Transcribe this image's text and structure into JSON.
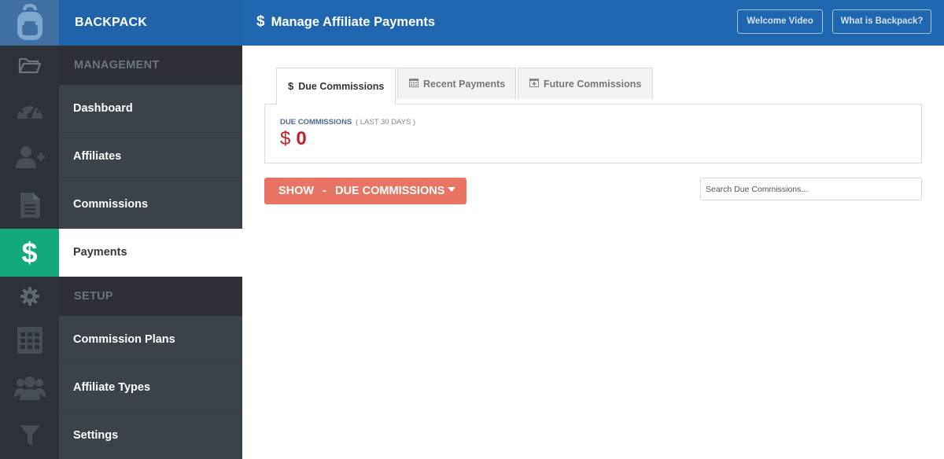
{
  "brand": {
    "name": "BACKPACK",
    "logo_icon": "backpack-icon"
  },
  "header": {
    "title_icon": "dollar",
    "title_icon_glyph": "$",
    "title": "Manage Affiliate Payments",
    "buttons": [
      {
        "label": "Welcome Video"
      },
      {
        "label": "What is Backpack?"
      }
    ]
  },
  "sidebar": {
    "sections": [
      {
        "title": "MANAGEMENT",
        "icon": "folder-open-icon",
        "items": [
          {
            "label": "Dashboard",
            "icon": "speedometer-icon"
          },
          {
            "label": "Affiliates",
            "icon": "add-user-icon"
          },
          {
            "label": "Commissions",
            "icon": "document-icon"
          },
          {
            "label": "Payments",
            "icon": "dollar-icon",
            "active": true
          }
        ]
      },
      {
        "title": "SETUP",
        "icon": "gear-icon",
        "items": [
          {
            "label": "Commission Plans",
            "icon": "calculator-icon"
          },
          {
            "label": "Affiliate Types",
            "icon": "users-icon"
          },
          {
            "label": "Settings",
            "icon": "filter-icon"
          }
        ]
      }
    ]
  },
  "tabs": [
    {
      "label": "Due Commissions",
      "icon": "dollar-icon",
      "active": true
    },
    {
      "label": "Recent Payments",
      "icon": "calendar-icon"
    },
    {
      "label": "Future Commissions",
      "icon": "calendar-plus-icon"
    }
  ],
  "summary": {
    "label": "DUE COMMISSIONS",
    "sublabel": "( LAST 30 DAYS )",
    "currency": "$",
    "value": "0"
  },
  "filter": {
    "show_label": "SHOW",
    "separator": "-",
    "selected": "DUE COMMISSIONS"
  },
  "search": {
    "placeholder": "Search Due Commissions..."
  },
  "colors": {
    "header_blue": "#1e66b0",
    "active_green": "#14a97a",
    "sidebar_dark": "#2d3138",
    "accent_red": "#c02026",
    "button_salmon": "#e97464"
  }
}
